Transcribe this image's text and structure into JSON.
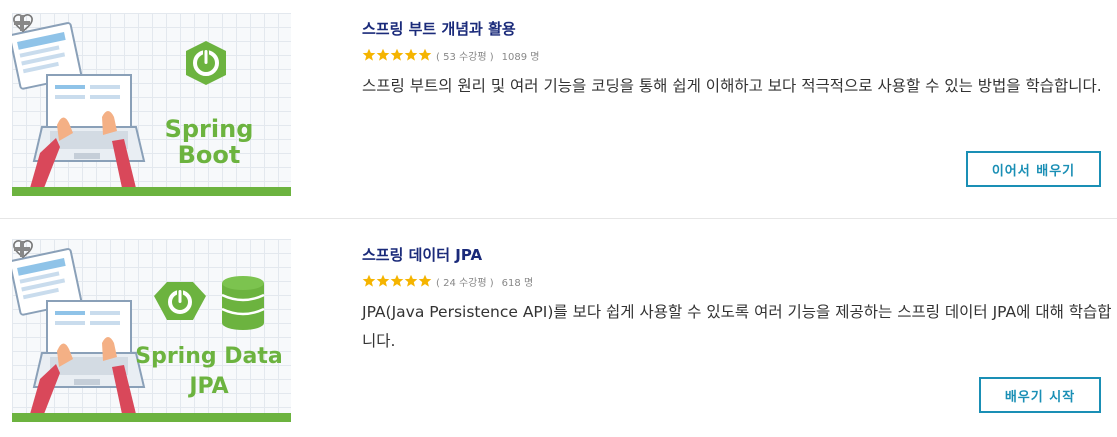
{
  "courses": [
    {
      "thumb_title": "Spring Boot",
      "title": "스프링 부트 개념과 활용",
      "rating_stars": 5,
      "rating_count": "( 53 수강평 )",
      "student_count": "1089 명",
      "description": "스프링 부트의 원리 및 여러 기능을 코딩을 통해 쉽게 이해하고 보다 적극적으로 사용할 수 있는 방법을 학습합니다.",
      "button_label": "이어서 배우기"
    },
    {
      "thumb_title_line1": "Spring Data",
      "thumb_title_line2": "JPA",
      "title": "스프링 데이터 JPA",
      "rating_stars": 5,
      "rating_count": "( 24 수강평 )",
      "student_count": "618 명",
      "description": "JPA(Java Persistence API)를 보다 쉽게 사용할 수 있도록 여러 기능을 제공하는 스프링 데이터 JPA에 대해 학습합니다.",
      "button_label": "배우기 시작"
    }
  ],
  "colors": {
    "accent": "#1a8fb5",
    "title": "#1a2a7a",
    "spring_green": "#6cb33f",
    "star": "#f5b400"
  },
  "icons": {
    "wishlist": "heart-icon",
    "add": "plus-icon",
    "star": "star-icon",
    "power": "power-icon",
    "database": "database-icon"
  }
}
